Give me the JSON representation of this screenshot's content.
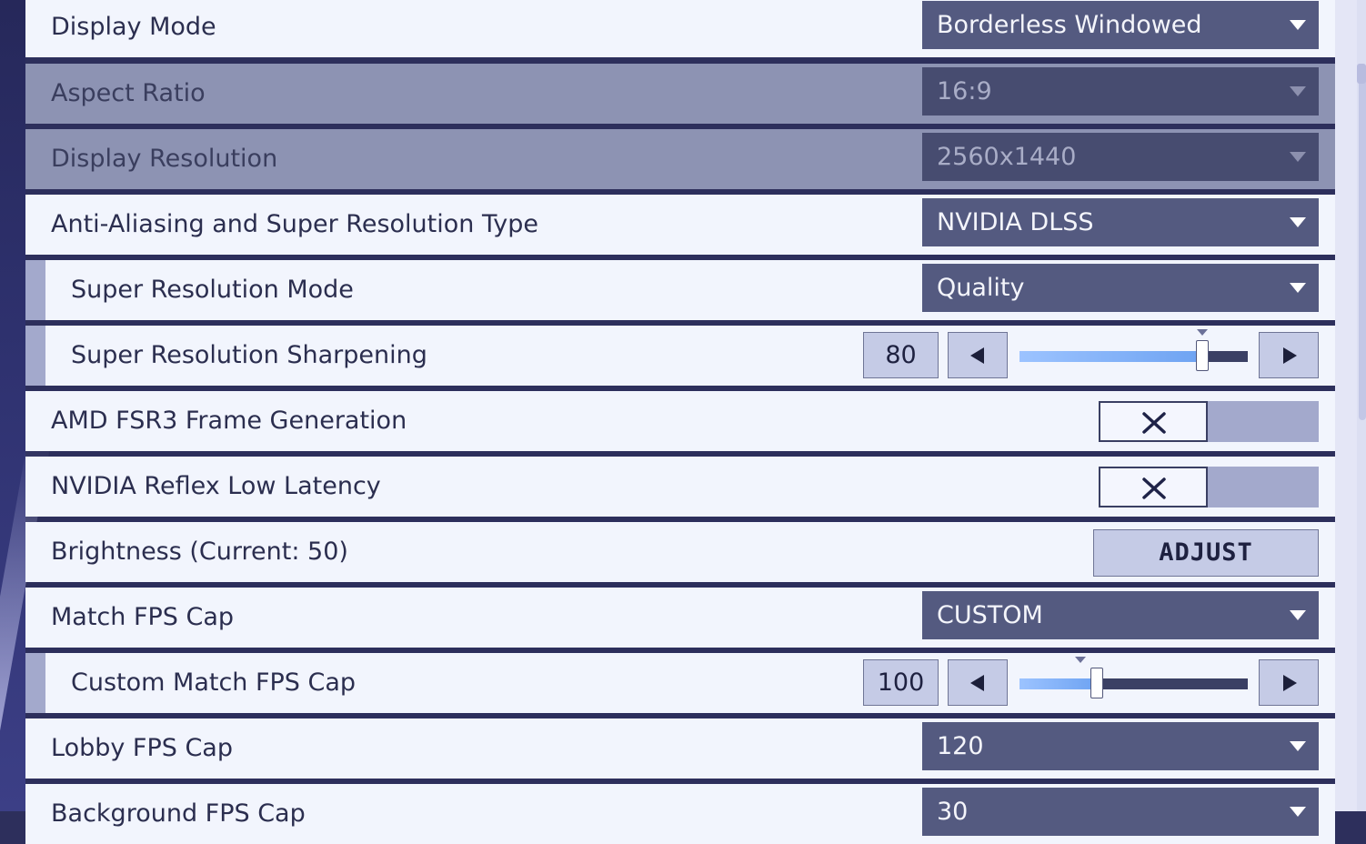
{
  "settings": {
    "display_mode": {
      "label": "Display Mode",
      "value": "Borderless Windowed"
    },
    "aspect_ratio": {
      "label": "Aspect Ratio",
      "value": "16:9"
    },
    "display_resolution": {
      "label": "Display Resolution",
      "value": "2560x1440"
    },
    "anti_aliasing": {
      "label": "Anti-Aliasing and Super Resolution Type",
      "value": "NVIDIA DLSS"
    },
    "super_resolution_mode": {
      "label": "Super Resolution Mode",
      "value": "Quality"
    },
    "super_resolution_sharpening": {
      "label": "Super Resolution Sharpening",
      "value": "80",
      "fill_percent": 80
    },
    "amd_fsr3": {
      "label": "AMD FSR3 Frame Generation",
      "state": "off"
    },
    "nvidia_reflex": {
      "label": "NVIDIA Reflex Low Latency",
      "state": "off"
    },
    "brightness": {
      "label": "Brightness (Current: 50)",
      "button": "ADJUST"
    },
    "match_fps_cap": {
      "label": "Match FPS Cap",
      "value": "CUSTOM"
    },
    "custom_match_fps_cap": {
      "label": "Custom Match FPS Cap",
      "value": "100",
      "fill_percent": 34
    },
    "lobby_fps_cap": {
      "label": "Lobby FPS Cap",
      "value": "120"
    },
    "background_fps_cap": {
      "label": "Background FPS Cap",
      "value": "30"
    }
  },
  "colors": {
    "row_bg": "#f2f5fd",
    "row_disabled_bg": "#8d93b3",
    "dropdown_bg": "#545a80",
    "slider_fill": "#7aaaf5",
    "button_bg": "#c5cbe6"
  },
  "icons": {
    "dropdown": "chevron-down-icon",
    "toggle_off": "x-icon",
    "step_left": "triangle-left-icon",
    "step_right": "triangle-right-icon"
  }
}
